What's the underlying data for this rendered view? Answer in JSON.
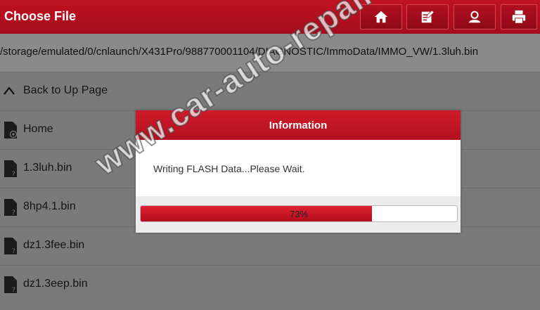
{
  "header": {
    "title": "Choose File",
    "buttons": [
      {
        "name": "home-button",
        "icon": "home-icon"
      },
      {
        "name": "report-button",
        "icon": "edit-note-icon"
      },
      {
        "name": "user-button",
        "icon": "user-icon"
      },
      {
        "name": "print-button",
        "icon": "print-icon"
      }
    ]
  },
  "path": "/storage/emulated/0/cnlaunch/X431Pro/988770001104/DIAGNOSTIC/ImmoData/IMMO_VW/1.3luh.bin",
  "list": {
    "back_label": "Back to Up Page",
    "items": [
      "Home",
      "1.3luh.bin",
      "8hp4.1.bin",
      "dz1.3fee.bin",
      "dz1.3eep.bin"
    ]
  },
  "dialog": {
    "title": "Information",
    "message": "Writing FLASH Data...Please Wait.",
    "progress_percent": 73,
    "progress_label": "73%"
  },
  "watermark": "www.car-auto-repair.com",
  "colors": {
    "accent": "#c01222",
    "background": "#7a7a7a",
    "progress": "#d21a2a"
  }
}
